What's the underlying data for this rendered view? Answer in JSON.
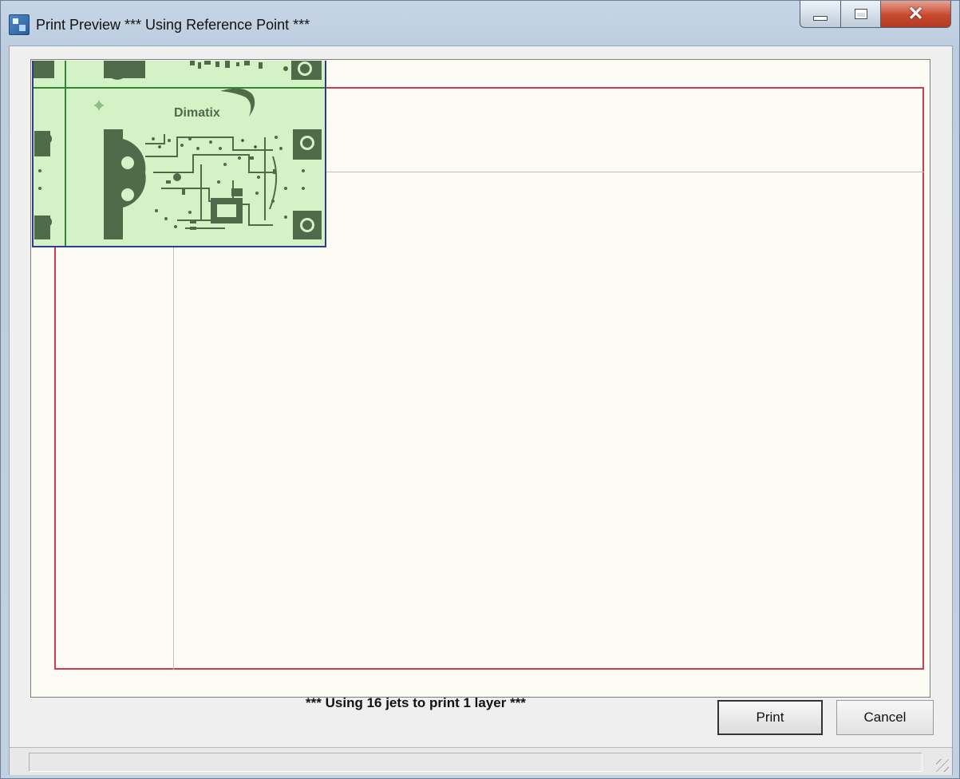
{
  "window": {
    "title": "Print Preview  *** Using Reference Point ***",
    "icon": "app-icon",
    "controls": [
      "minimize-icon",
      "maximize-icon",
      "close-icon"
    ]
  },
  "preview": {
    "logo_text": "Dimatix",
    "colors": {
      "paper": "#fcfcf5",
      "print_area_border": "#d13a4c",
      "guide_line": "#bdbdbd",
      "pcb_fill": "#d5f1c6",
      "pcb_traces": "#4e6b4a",
      "pcb_border": "#2b3e8e",
      "pcb_guide": "#2f8a2f"
    }
  },
  "footer": {
    "status_message": "*** Using 16 jets to print 1 layer ***",
    "print_label": "Print",
    "cancel_label": "Cancel"
  }
}
